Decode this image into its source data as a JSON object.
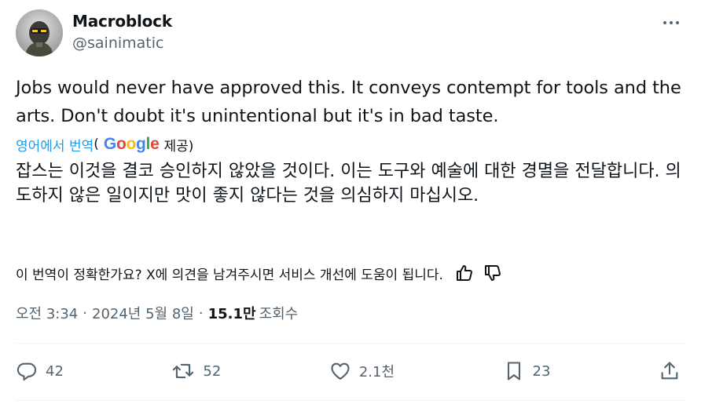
{
  "author": {
    "display_name": "Macroblock",
    "handle": "@sainimatic"
  },
  "tweet": {
    "text": "Jobs would never have approved this. It conveys contempt for tools and the arts. Don't doubt it's unintentional but it's in bad taste."
  },
  "translation": {
    "link_label": "영어에서 번역",
    "open_paren": "(",
    "google_letters": [
      "G",
      "o",
      "o",
      "g",
      "l",
      "e"
    ],
    "provided_label": "제공)",
    "text": "잡스는 이것을 결코 승인하지 않았을 것이다. 이는 도구와 예술에 대한 경멸을 전달합니다. 의도하지 않은 일이지만 맛이 좋지 않다는 것을 의심하지 마십시오.",
    "feedback_prompt": "이 번역이 정확한가요? X에 의견을 남겨주시면 서비스 개선에 도움이 됩니다."
  },
  "meta": {
    "time": "오전 3:34",
    "separator": "·",
    "date": "2024년 5월 8일",
    "views_count": "15.1만",
    "views_label": "조회수"
  },
  "actions": {
    "replies": "42",
    "reposts": "52",
    "likes": "2.1천"
  },
  "bookmarks": "23",
  "colors": {
    "text_primary": "#0f1419",
    "text_secondary": "#536471",
    "link": "#1d9bf0",
    "divider": "#eff3f4"
  },
  "icons": [
    "more-icon",
    "thumbs-up-icon",
    "thumbs-down-icon",
    "reply-icon",
    "repost-icon",
    "like-icon",
    "bookmark-icon",
    "share-icon"
  ]
}
